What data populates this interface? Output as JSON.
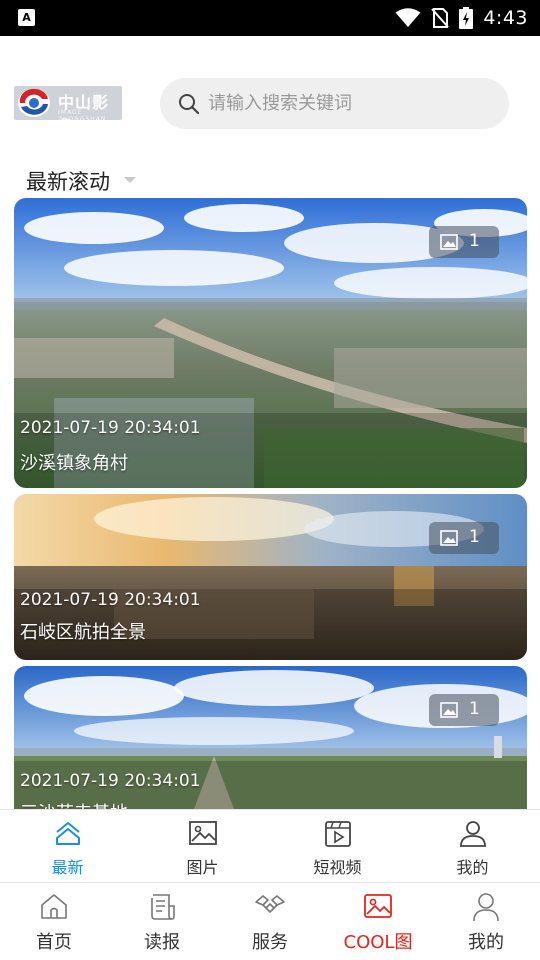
{
  "status_bar": {
    "time": "4:43",
    "left_icon_label": "A"
  },
  "header": {
    "logo": {
      "text": "中山影像",
      "subtitle": "IMAGE ZHONGSHAN"
    },
    "search": {
      "placeholder": "请输入搜索关键词"
    }
  },
  "section": {
    "title": "最新滚动"
  },
  "cards": [
    {
      "date": "2021-07-19 20:34:01",
      "title": "沙溪镇象角村",
      "count": "1"
    },
    {
      "date": "2021-07-19 20:34:01",
      "title": "石岐区航拍全景",
      "count": "1"
    },
    {
      "date": "2021-07-19 20:34:01",
      "title": "三沙花卉基地",
      "count": "1"
    }
  ],
  "subtabs": [
    {
      "label": "最新",
      "icon": "home-outline-icon",
      "active": true
    },
    {
      "label": "图片",
      "icon": "picture-icon",
      "active": false
    },
    {
      "label": "短视频",
      "icon": "video-icon",
      "active": false
    },
    {
      "label": "我的",
      "icon": "user-icon",
      "active": false
    }
  ],
  "bottom_nav": [
    {
      "label": "首页",
      "icon": "house-icon",
      "active": false
    },
    {
      "label": "读报",
      "icon": "newspaper-icon",
      "active": false
    },
    {
      "label": "服务",
      "icon": "handshake-icon",
      "active": false
    },
    {
      "label": "COOL图",
      "icon": "image-icon",
      "active": true
    },
    {
      "label": "我的",
      "icon": "person-icon",
      "active": false
    }
  ],
  "colors": {
    "accent_blue": "#1b8ee0",
    "accent_red": "#e2261d",
    "text_dark": "#222222",
    "search_bg": "#efefef"
  }
}
